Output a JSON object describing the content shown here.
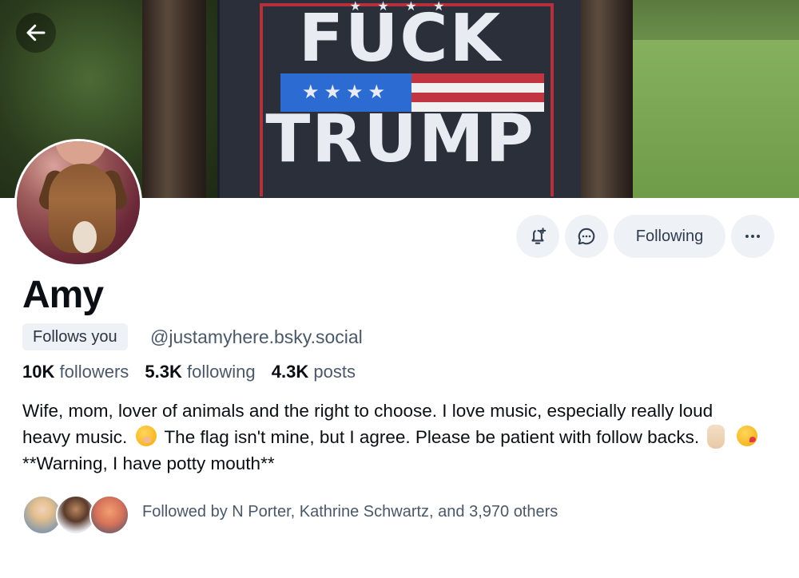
{
  "banner": {
    "flag_top_word": "FUCK",
    "flag_bottom_word": "TRUMP"
  },
  "profile": {
    "name": "Amy",
    "follows_you_badge": "Follows you",
    "handle": "@justamyhere.bsky.social"
  },
  "actions": {
    "following_label": "Following"
  },
  "stats": {
    "followers_count": "10K",
    "followers_label": "followers",
    "following_count": "5.3K",
    "following_label": "following",
    "posts_count": "4.3K",
    "posts_label": "posts"
  },
  "bio": {
    "part1": "Wife, mom, lover of animals and the right to choose. I love music, especially really loud heavy music.",
    "part2": "The flag isn't mine, but I agree. Please be patient with follow backs.",
    "part3": "**Warning, I have potty mouth**"
  },
  "followed_by": {
    "text": "Followed by N Porter, Kathrine Schwartz, and 3,970 others"
  },
  "icons": {
    "back": "arrow-left-icon",
    "subscribe": "bell-plus-icon",
    "message": "chat-bubble-icon",
    "more": "ellipsis-icon"
  }
}
